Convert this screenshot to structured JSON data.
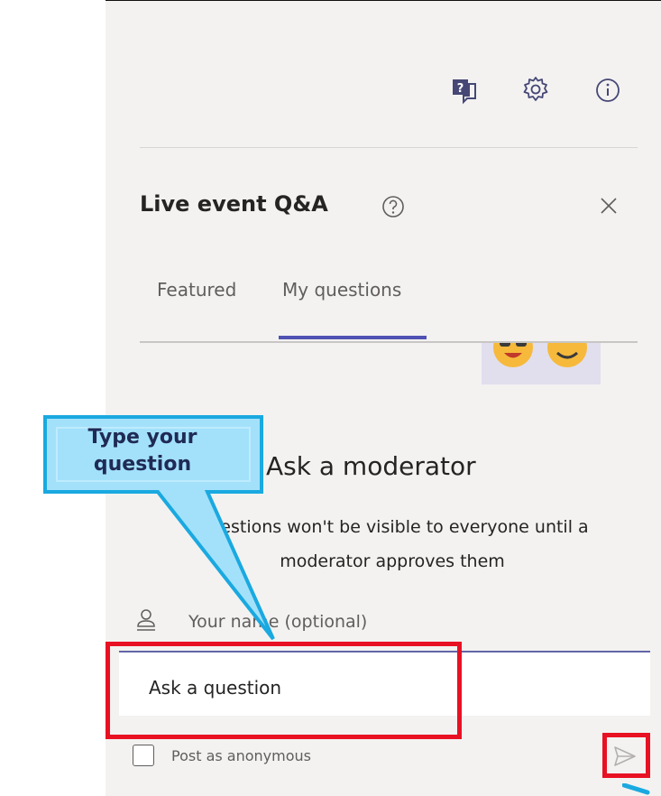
{
  "header_icons": [
    "qa-icon",
    "settings-gear-icon",
    "info-icon"
  ],
  "title": "Live event Q&A",
  "tabs": [
    {
      "label": "Featured",
      "active": false
    },
    {
      "label": "My questions",
      "active": true
    }
  ],
  "ask": {
    "heading": "Ask a moderator",
    "description_line1": "Questions won't be visible to everyone until a",
    "description_line2": "moderator approves them",
    "name_placeholder": "Your name (optional)",
    "question_placeholder": "Ask a question",
    "anonymous_label": "Post as anonymous"
  },
  "callout": {
    "line1": "Type your",
    "line2": "question"
  },
  "colors": {
    "accent": "#4f52b2",
    "panel_bg": "#f3f2f1",
    "highlight_red": "#e81123",
    "callout_fill": "#a3e1fb",
    "callout_border": "#1aa9e0"
  }
}
